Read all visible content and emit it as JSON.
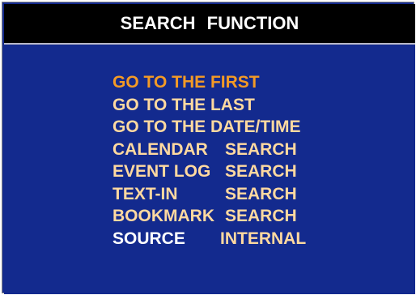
{
  "title": "SEARCH  FUNCTION",
  "colors": {
    "background": "#132a8e",
    "title_bar": "#000000",
    "item_text": "#ffd9a0",
    "selected_item": "#f39a26",
    "source_label": "#ffffff"
  },
  "menu": {
    "items": [
      {
        "label": "GO TO THE FIRST"
      },
      {
        "label": "GO TO THE LAST"
      },
      {
        "label": "GO TO THE DATE/TIME"
      },
      {
        "label": "CALENDAR",
        "value": "SEARCH"
      },
      {
        "label": "EVENT LOG",
        "value": "SEARCH"
      },
      {
        "label": "TEXT-IN",
        "value": "SEARCH"
      },
      {
        "label": "BOOKMARK",
        "value": "SEARCH"
      }
    ],
    "source": {
      "label": "SOURCE",
      "value": "INTERNAL"
    }
  }
}
